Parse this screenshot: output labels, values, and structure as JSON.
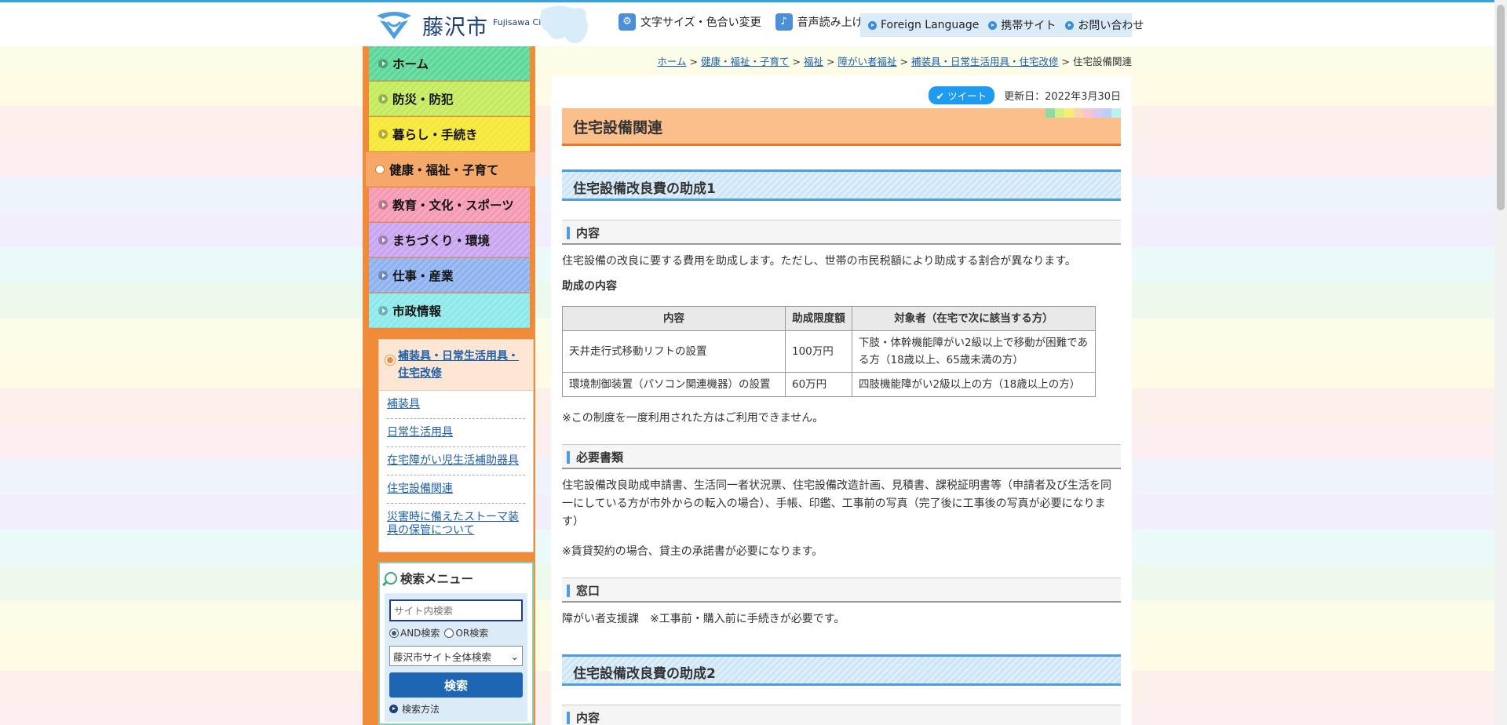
{
  "header": {
    "logo_text": "藤沢市",
    "logo_en": "Fujisawa City",
    "tools": [
      {
        "label": "文字サイズ・色合い変更",
        "icon": "gear-icon"
      },
      {
        "label": "音声読み上げ",
        "icon": "speaker-icon"
      }
    ],
    "links": [
      "Foreign Language",
      "携帯サイト",
      "お問い合わせ"
    ]
  },
  "nav": [
    {
      "label": "ホーム",
      "color": "#5ed89a"
    },
    {
      "label": "防災・防犯",
      "color": "#c4ea5e"
    },
    {
      "label": "暮らし・手続き",
      "color": "#f7e736"
    },
    {
      "label": "健康・福祉・子育て",
      "color": "#f6a868"
    },
    {
      "label": "教育・文化・スポーツ",
      "color": "#f59ab3"
    },
    {
      "label": "まちづくり・環境",
      "color": "#c9a6ef"
    },
    {
      "label": "仕事・産業",
      "color": "#8fb3f0"
    },
    {
      "label": "市政情報",
      "color": "#8eeaea"
    }
  ],
  "subnav": {
    "heading": "補装具・日常生活用具・住宅改修",
    "items": [
      "補装具",
      "日常生活用具",
      "在宅障がい児生活補助器具",
      "住宅設備関連",
      "災害時に備えたストーマ装具の保管について"
    ]
  },
  "search": {
    "title": "検索メニュー",
    "placeholder": "サイト内検索",
    "and_label": "AND検索",
    "or_label": "OR検索",
    "scope": "藤沢市サイト全体検索",
    "button": "検索",
    "howto": "検索方法"
  },
  "breadcrumb": [
    "ホーム",
    "健康・福祉・子育て",
    "福祉",
    "障がい者福祉",
    "補装具・日常生活用具・住宅改修",
    "住宅設備関連"
  ],
  "meta": {
    "tweet": "ツイート",
    "updated": "更新日：2022年3月30日"
  },
  "page": {
    "title": "住宅設備関連",
    "section1": {
      "heading": "住宅設備改良費の助成1",
      "h_content": "内容",
      "content_text": "住宅設備の改良に要する費用を助成します。ただし、世帯の市民税額により助成する割合が異なります。",
      "sub_heading": "助成の内容",
      "table": {
        "headers": [
          "内容",
          "助成限度額",
          "対象者（在宅で次に該当する方）"
        ],
        "rows": [
          [
            "天井走行式移動リフトの設置",
            "100万円",
            "下肢・体幹機能障がい2級以上で移動が困難である方（18歳以上、65歳未満の方）"
          ],
          [
            "環境制御装置（パソコン関連機器）の設置",
            "60万円",
            "四肢機能障がい2級以上の方（18歳以上の方）"
          ]
        ]
      },
      "note": "※この制度を一度利用された方はご利用できません。",
      "h_docs": "必要書類",
      "docs_text": "住宅設備改良助成申請書、生活同一者状況票、住宅設備改造計画、見積書、課税証明書等（申請者及び生活を同一にしている方が市外からの転入の場合）、手帳、印鑑、工事前の写真（完了後に工事後の写真が必要になります）",
      "docs_note": "※賃貸契約の場合、貸主の承諾書が必要になります。",
      "h_window": "窓口",
      "window_text": "障がい者支援課　※工事前・購入前に手続きが必要です。"
    },
    "section2": {
      "heading": "住宅設備改良費の助成2",
      "h_content": "内容"
    }
  }
}
